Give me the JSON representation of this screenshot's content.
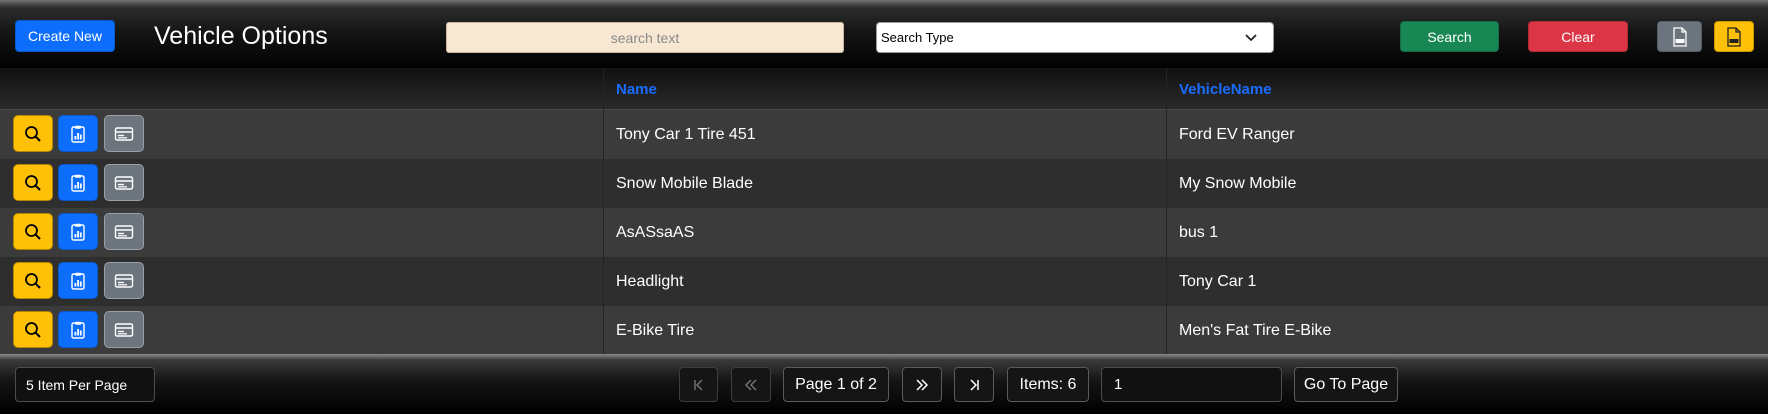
{
  "header": {
    "create_label": "Create New",
    "title": "Vehicle Options",
    "search_placeholder": "search text",
    "search_type_label": "Search Type",
    "search_label": "Search",
    "clear_label": "Clear",
    "export_csv_icon": "csv-file-icon",
    "export_pdf_icon": "pdf-file-icon"
  },
  "table": {
    "columns": [
      "",
      "Name",
      "VehicleName"
    ],
    "action_icons": [
      "search-icon",
      "report-icon",
      "details-icon"
    ],
    "rows": [
      {
        "name": "Tony Car 1 Tire 451",
        "vehicle": "Ford EV Ranger"
      },
      {
        "name": "Snow Mobile Blade",
        "vehicle": "My Snow Mobile"
      },
      {
        "name": "AsASsaAS",
        "vehicle": "bus 1"
      },
      {
        "name": "Headlight",
        "vehicle": "Tony Car 1"
      },
      {
        "name": "E-Bike Tire",
        "vehicle": "Men's Fat Tire E-Bike"
      }
    ]
  },
  "footer": {
    "per_page": "5 Item Per Page",
    "page_label": "Page 1 of 2",
    "items_label": "Items: 6",
    "goto_value": "1",
    "goto_label": "Go To Page"
  },
  "colors": {
    "primary": "#0d6efd",
    "success": "#198754",
    "danger": "#dc3545",
    "warning": "#ffc107",
    "secondary": "#6c757d",
    "header_link": "#1a6dff"
  }
}
